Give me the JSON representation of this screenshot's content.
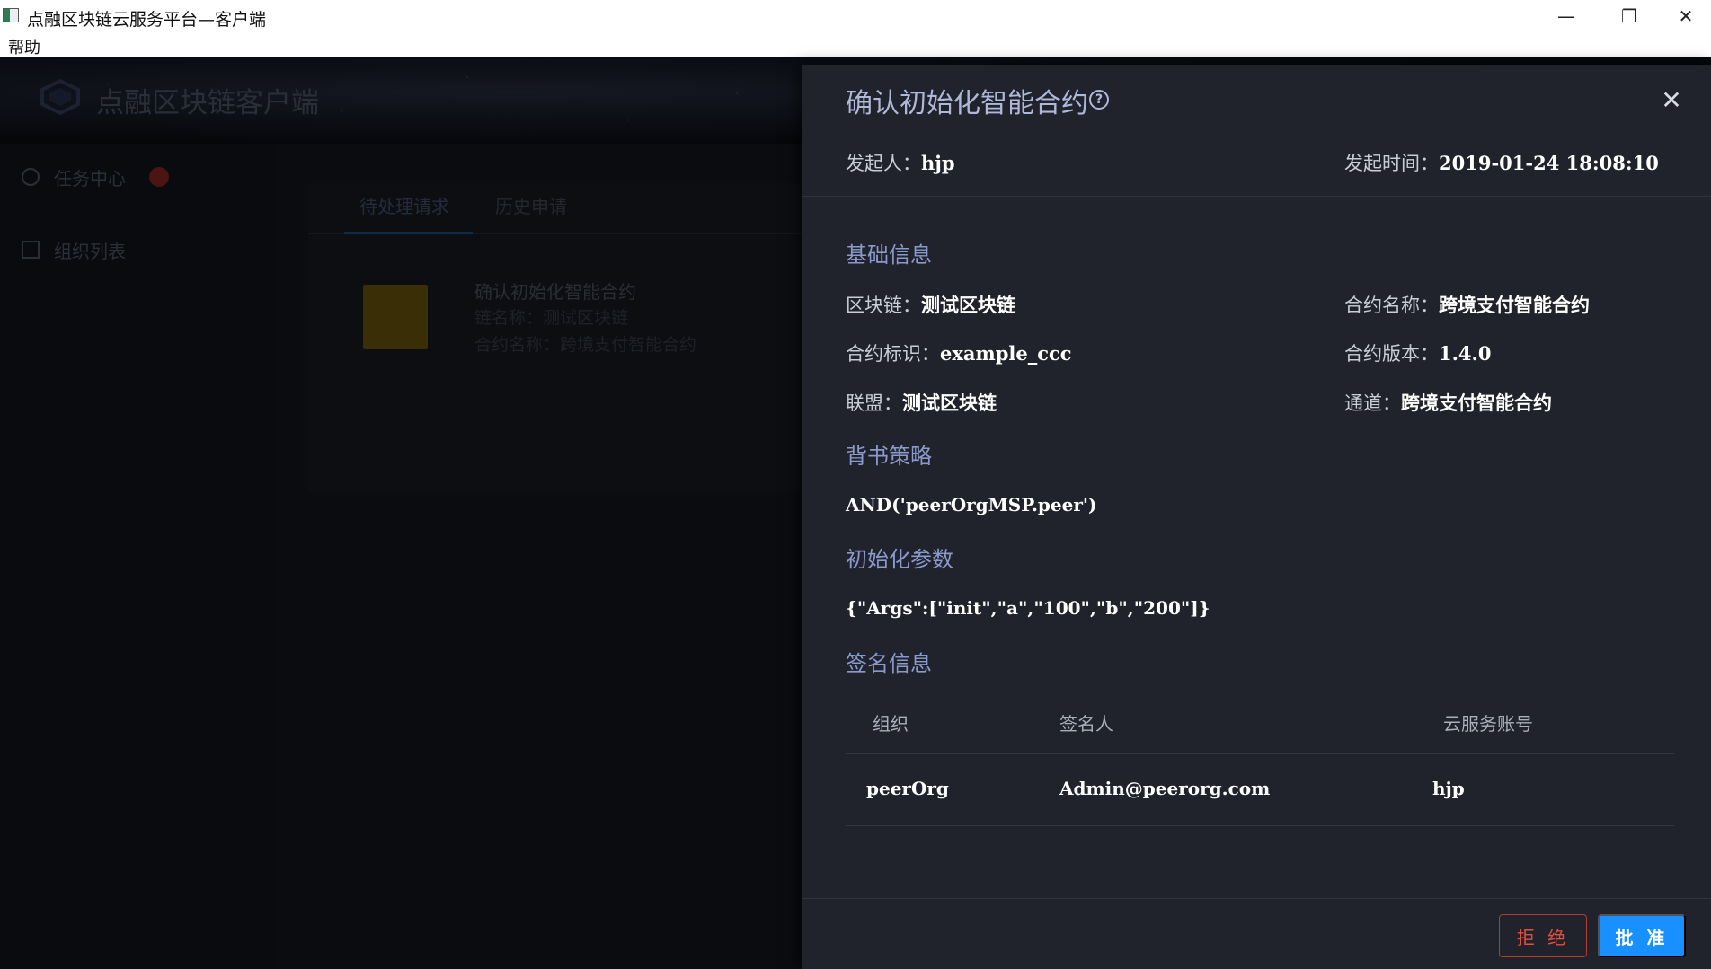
{
  "window": {
    "title": "点融区块链云服务平台—客户端",
    "min_glyph": "—",
    "max_glyph": "❐",
    "close_glyph": "✕",
    "menu_help": "帮助"
  },
  "background_app": {
    "brand": "点融区块链客户端",
    "sidebar": [
      {
        "label": "任务中心",
        "icon": "check-circle-icon"
      },
      {
        "label": "组织列表",
        "icon": "list-icon"
      }
    ],
    "tabs": [
      "待处理请求",
      "历史申请"
    ],
    "task": {
      "title": "确认初始化智能合约",
      "line1": "链名称：测试区块链",
      "line2": "合约名称：跨境支付智能合约"
    }
  },
  "drawer": {
    "title": "确认初始化智能合约",
    "help_icon_glyph": "?",
    "close_glyph": "✕",
    "initiator_label": "发起人：",
    "initiator": "hjp",
    "time_label": "发起时间：",
    "time": "2019-01-24 18:08:10",
    "basic_title": "基础信息",
    "chain_label": "区块链：",
    "chain": "测试区块链",
    "contract_name_label": "合约名称：",
    "contract_name": "跨境支付智能合约",
    "contract_id_label": "合约标识：",
    "contract_id": "example_ccc",
    "contract_version_label": "合约版本：",
    "contract_version": "1.4.0",
    "alliance_label": "联盟：",
    "alliance": "测试区块链",
    "channel_label": "通道：",
    "channel": "跨境支付智能合约",
    "endorse_title": "背书策略",
    "endorse_policy": "AND('peerOrgMSP.peer')",
    "init_title": "初始化参数",
    "init_params": "{\"Args\":[\"init\",\"a\",\"100\",\"b\",\"200\"]}",
    "sign_title": "签名信息",
    "sign_columns": [
      "组织",
      "签名人",
      "云服务账号"
    ],
    "sign_rows": [
      [
        "peerOrg",
        "Admin@peerorg.com",
        "hjp"
      ]
    ],
    "reject_label": "拒 绝",
    "approve_label": "批 准"
  },
  "colors": {
    "drawer_bg": "#20222c",
    "accent": "#1890ff",
    "danger": "#e0503f",
    "section_title": "#8a9acb"
  }
}
